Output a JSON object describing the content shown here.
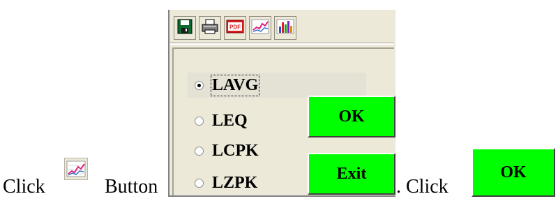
{
  "instruction": {
    "click_text_1": "Click",
    "button_text": "Button",
    "click_text_2": ". Click"
  },
  "toolbar": {
    "icons": [
      "save-icon",
      "print-icon",
      "pdf-icon",
      "line-chart-icon",
      "bar-chart-icon"
    ],
    "pdf_label": "PDF"
  },
  "options": {
    "selected": "LAVG",
    "items": [
      {
        "label": "LAVG",
        "checked": true
      },
      {
        "label": "LEQ",
        "checked": false
      },
      {
        "label": "LCPK",
        "checked": false
      },
      {
        "label": "LZPK",
        "checked": false
      }
    ]
  },
  "buttons": {
    "ok_label": "OK",
    "exit_label": "Exit",
    "standalone_ok_label": "OK",
    "color": "#00ff00"
  }
}
